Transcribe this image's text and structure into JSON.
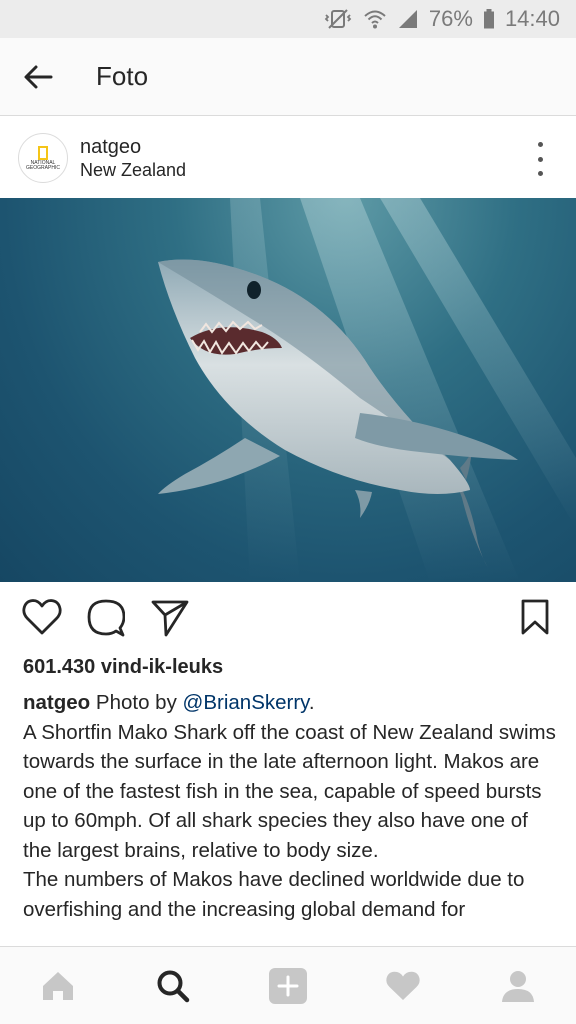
{
  "status_bar": {
    "battery": "76%",
    "time": "14:40",
    "icons": [
      "mute-vibrate-icon",
      "wifi-icon",
      "signal-icon",
      "battery-icon"
    ]
  },
  "header": {
    "back_icon": "arrow-left-icon",
    "title": "Foto"
  },
  "post": {
    "username": "natgeo",
    "location": "New Zealand",
    "avatar_text": "NATIONAL GEOGRAPHIC",
    "menu_icon": "more-vertical-icon",
    "likes": "601.430 vind-ik-leuks",
    "caption": {
      "username": "natgeo",
      "text_prefix": "Photo by ",
      "mention": "@BrianSkerry",
      "text_suffix": ".",
      "paragraph1": "A Shortfin Mako Shark off the coast of New Zealand swims towards the surface in the late afternoon light. Makos are one of the fastest fish in the sea, capable of speed bursts up to 60mph. Of all shark species they also have one of the largest brains, relative to body size.",
      "paragraph2": "The numbers of Makos have declined worldwide due to overfishing and the increasing global demand for"
    },
    "action_icons": [
      "heart-icon",
      "comment-icon",
      "share-icon",
      "bookmark-icon"
    ]
  },
  "bottom_nav": {
    "items": [
      "home-icon",
      "search-icon",
      "add-icon",
      "activity-icon",
      "profile-icon"
    ]
  },
  "colors": {
    "mention": "#003569",
    "text": "#262626",
    "nav_inactive": "#c7c7c7",
    "nav_active": "#262626"
  }
}
